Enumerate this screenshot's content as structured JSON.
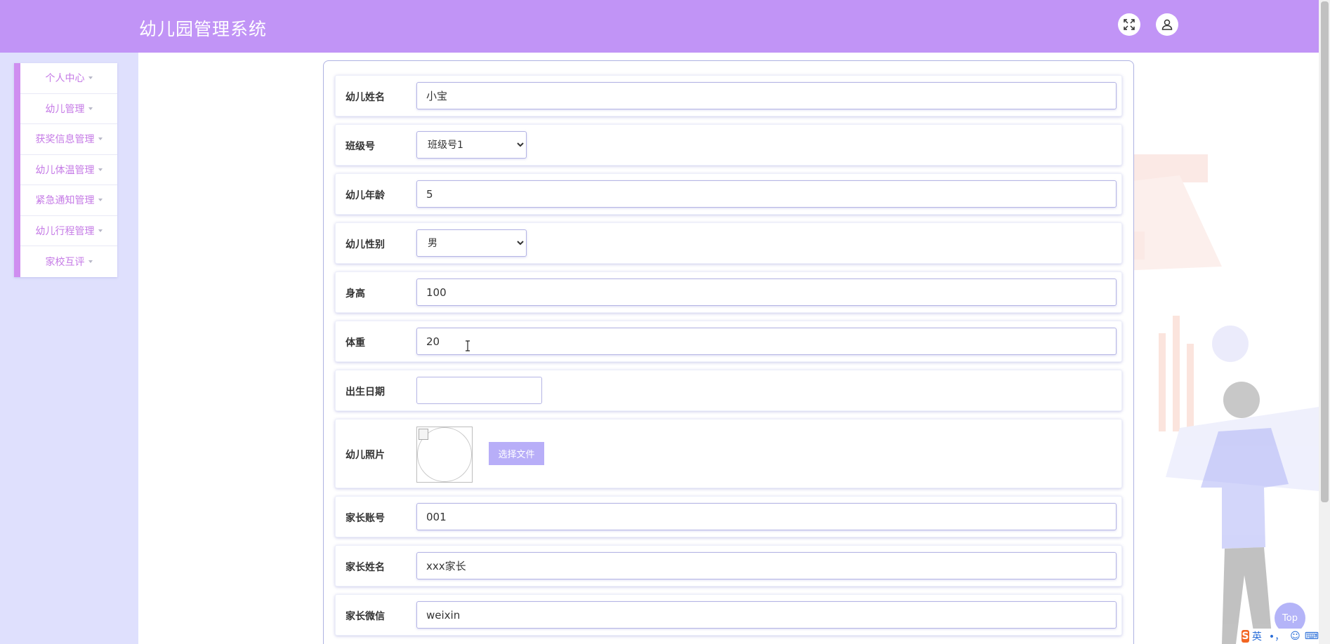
{
  "app": {
    "title": "幼儿园管理系统"
  },
  "header": {
    "fullscreen_icon": "fullscreen-icon",
    "user_icon": "user-icon"
  },
  "sidebar": {
    "items": [
      {
        "label": "个人中心"
      },
      {
        "label": "幼儿管理"
      },
      {
        "label": "获奖信息管理"
      },
      {
        "label": "幼儿体温管理"
      },
      {
        "label": "紧急通知管理"
      },
      {
        "label": "幼儿行程管理"
      },
      {
        "label": "家校互评"
      }
    ]
  },
  "form": {
    "name": {
      "label": "幼儿姓名",
      "value": "小宝"
    },
    "class": {
      "label": "班级号",
      "selected": "班级号1"
    },
    "age": {
      "label": "幼儿年龄",
      "value": "5"
    },
    "gender": {
      "label": "幼儿性别",
      "selected": "男"
    },
    "height": {
      "label": "身高",
      "value": "100"
    },
    "weight": {
      "label": "体重",
      "value": "20"
    },
    "birthday": {
      "label": "出生日期",
      "value": ""
    },
    "photo": {
      "label": "幼儿照片",
      "button": "选择文件"
    },
    "parent_account": {
      "label": "家长账号",
      "value": "001"
    },
    "parent_name": {
      "label": "家长姓名",
      "value": "xxx家长"
    },
    "parent_wechat": {
      "label": "家长微信",
      "value": "weixin"
    }
  },
  "back_to_top": {
    "label": "Top"
  },
  "ime_tray": {
    "logo": "S",
    "lang": "英",
    "symbols": "•，"
  },
  "colors": {
    "header": "#c194f6",
    "sidebar_bg": "#dfe0fd",
    "accent": "#cf8ef0",
    "menu_text": "#c57ae6",
    "button": "#b8aef8"
  }
}
